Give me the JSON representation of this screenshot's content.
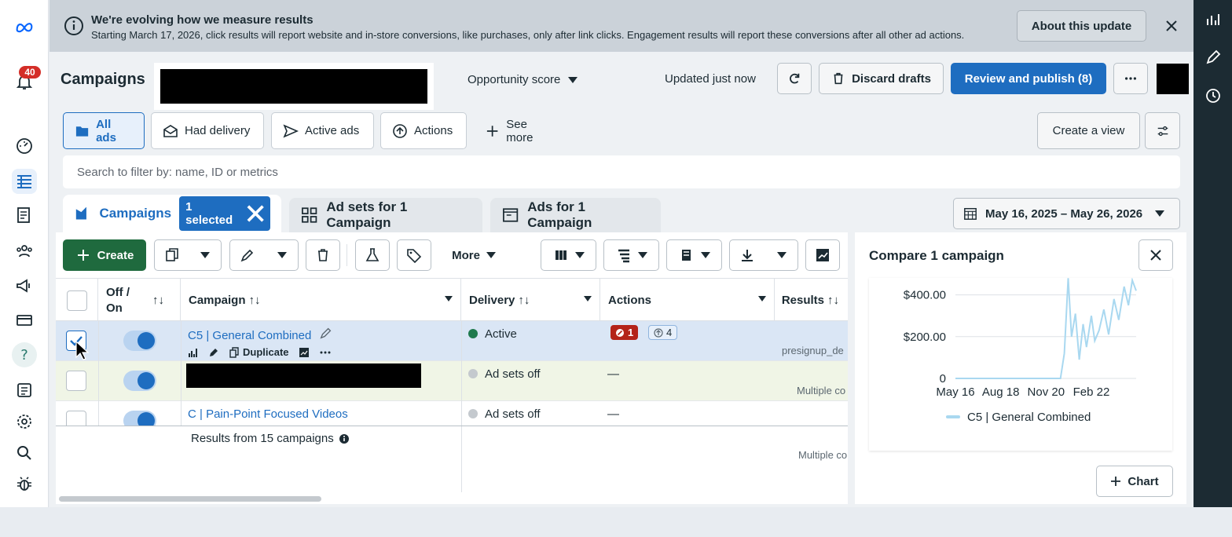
{
  "left_nav": {
    "notification_count": "40",
    "items": [
      "meta-logo",
      "notifications",
      "dashboard",
      "campaigns-table",
      "reports",
      "audiences",
      "ads-manager",
      "billing",
      "help",
      "news",
      "settings",
      "search",
      "bug-report"
    ]
  },
  "banner": {
    "title": "We're evolving how we measure results",
    "text": "Starting March 17, 2026, click results will report website and in-store conversions, like purchases, only after link clicks. Engagement results will report these conversions after all other ad actions.",
    "about_button": "About this update"
  },
  "header": {
    "title": "Campaigns",
    "opportunity_score": "Opportunity score",
    "updated": "Updated just now",
    "discard_drafts": "Discard drafts",
    "review_publish": "Review and publish (8)"
  },
  "views": {
    "all_ads": "All ads",
    "had_delivery": "Had delivery",
    "active_ads": "Active ads",
    "actions": "Actions",
    "see_more": "See more",
    "create_view": "Create a view"
  },
  "search": {
    "placeholder": "Search to filter by: name, ID or metrics"
  },
  "level_tabs": {
    "campaigns": "Campaigns",
    "selected": "1 selected",
    "ad_sets": "Ad sets for 1 Campaign",
    "ads": "Ads for 1 Campaign"
  },
  "date_range": "May 16, 2025 – May 26, 2026",
  "toolbar": {
    "create": "Create",
    "more": "More"
  },
  "table": {
    "columns": {
      "off_on": "Off / On",
      "campaign": "Campaign",
      "delivery": "Delivery",
      "actions": "Actions",
      "results": "Results"
    },
    "rows": [
      {
        "name": "C5 | General Combined",
        "duplicate": "Duplicate",
        "delivery": "Active",
        "delivery_color": "#1f7a4d",
        "action_errors": "1",
        "action_recs": "4",
        "results_sub": "presignup_de"
      },
      {
        "name": "",
        "delivery": "Ad sets off",
        "delivery_color": "#c4c9ce",
        "actions": "—",
        "results_sub": "Multiple co"
      },
      {
        "name": "C | Pain-Point Focused Videos",
        "delivery": "Ad sets off",
        "delivery_color": "#c4c9ce",
        "actions": "—"
      }
    ],
    "footer": {
      "summary": "Results from 15 campaigns",
      "results_sub": "Multiple co"
    }
  },
  "compare": {
    "title": "Compare 1 campaign",
    "chart_button": "Chart"
  },
  "chart_data": {
    "type": "line",
    "y_ticks": [
      "$400.00",
      "$200.00",
      "0"
    ],
    "ylim": [
      0,
      500
    ],
    "x_ticks": [
      "May 16",
      "Aug 18",
      "Nov 20",
      "Feb 22"
    ],
    "series": [
      {
        "name": "C5 | General Combined",
        "color": "#a9d8f0",
        "x": [
          "2025-05-16",
          "2025-08-18",
          "2025-11-20",
          "2025-12-20",
          "2025-12-28",
          "2026-01-05",
          "2026-01-12",
          "2026-01-20",
          "2026-01-28",
          "2026-02-05",
          "2026-02-12",
          "2026-02-22",
          "2026-03-01",
          "2026-03-10",
          "2026-03-20",
          "2026-03-30",
          "2026-04-10",
          "2026-04-20",
          "2026-05-01",
          "2026-05-10",
          "2026-05-18",
          "2026-05-26"
        ],
        "values": [
          0,
          0,
          0,
          0,
          120,
          480,
          200,
          310,
          90,
          260,
          150,
          300,
          180,
          230,
          330,
          210,
          380,
          280,
          440,
          350,
          470,
          420
        ]
      }
    ],
    "legend": "bottom"
  }
}
